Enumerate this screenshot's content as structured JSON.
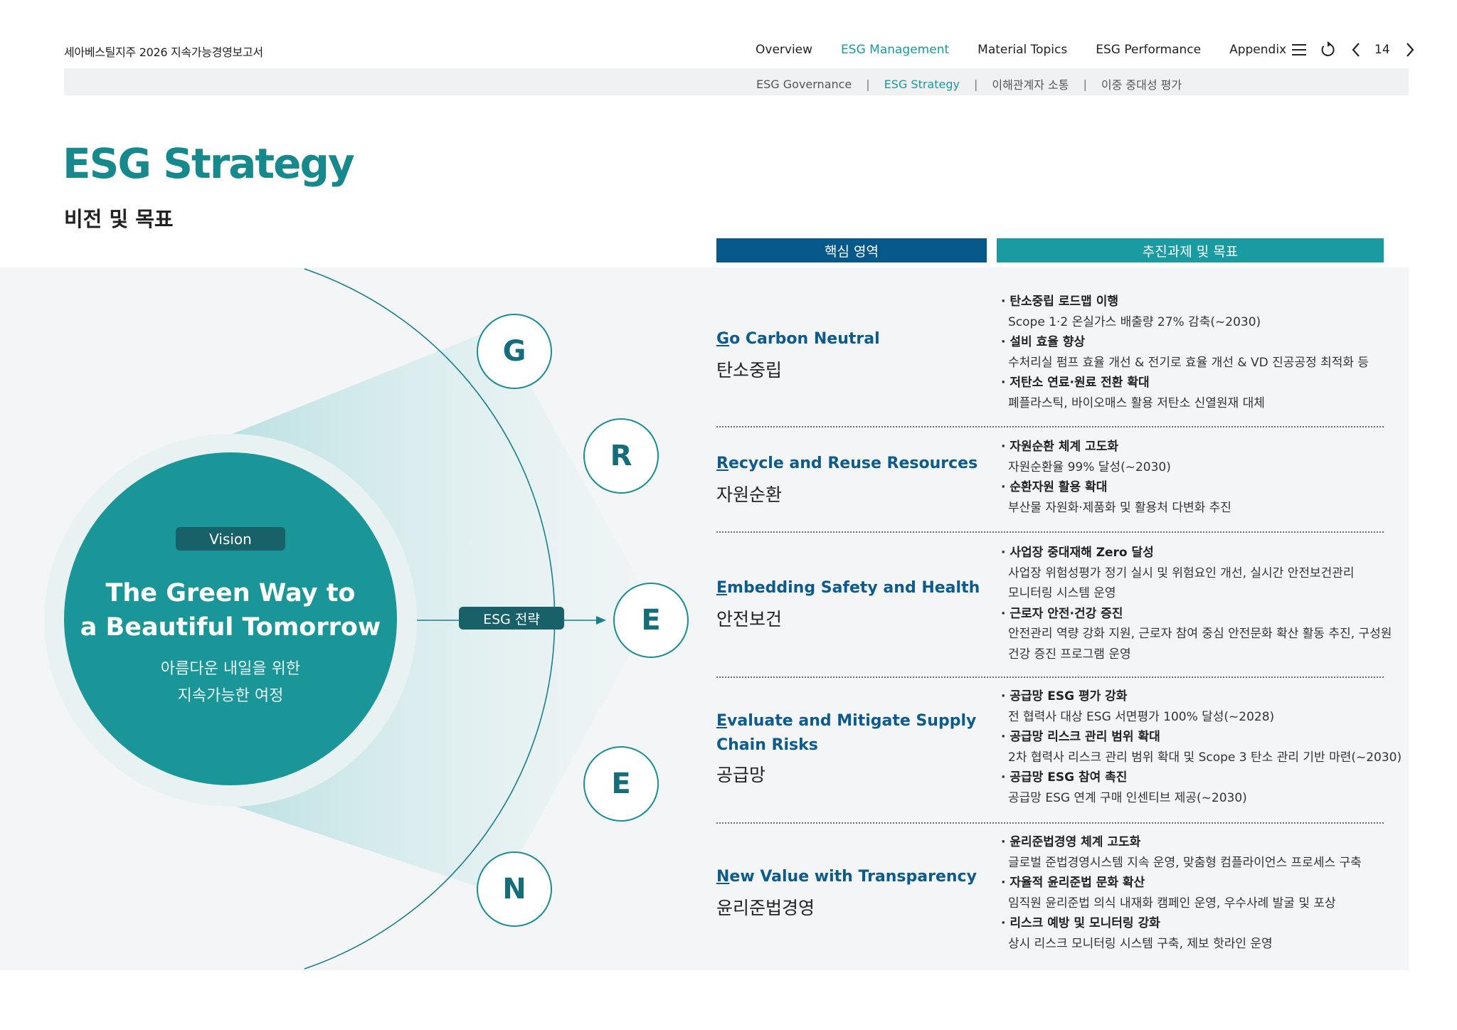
{
  "header": {
    "doc_title": "세아베스틸지주 2026 지속가능경영보고서",
    "nav": [
      {
        "label": "Overview"
      },
      {
        "label": "ESG Management"
      },
      {
        "label": "Material Topics"
      },
      {
        "label": "ESG Performance"
      },
      {
        "label": "Appendix"
      }
    ],
    "active_nav": "ESG Management",
    "page_number": "14",
    "icons": [
      "menu-icon",
      "refresh-icon",
      "prev-page-icon",
      "next-page-icon"
    ]
  },
  "subnav": {
    "items": [
      "ESG Governance",
      "ESG Strategy",
      "이해관계자 소통",
      "이중 중대성 평가"
    ],
    "separator": "|",
    "active": "ESG Strategy"
  },
  "page": {
    "title": "ESG Strategy",
    "subtitle": "비전 및 목표"
  },
  "table_headers": {
    "core_area": "핵심 영역",
    "tasks_goals": "추진과제 및 목표"
  },
  "vision": {
    "badge": "Vision",
    "english_line1": "The Green Way to",
    "english_line2": "a Beautiful Tomorrow",
    "korean_line1": "아름다운 내일을 위한",
    "korean_line2": "지속가능한 여정",
    "strategy_label": "ESG 전략"
  },
  "letters": [
    "G",
    "R",
    "E",
    "E",
    "N"
  ],
  "areas": [
    {
      "initial": "G",
      "english_rest": "o Carbon Neutral",
      "english_rest_line2": "",
      "korean": "탄소중립",
      "tasks": [
        {
          "title": "· 탄소중립 로드맵 이행",
          "desc": "Scope 1·2  온실가스 배출량 27% 감축(~2030)"
        },
        {
          "title": "· 설비 효율 향상",
          "desc": "수처리실 펌프 효율 개선 & 전기로 효율 개선 & VD 진공공정 최적화 등"
        },
        {
          "title": "· 저탄소 연료·원료 전환 확대",
          "desc": "폐플라스틱, 바이오매스 활용 저탄소 신열원재 대체"
        }
      ]
    },
    {
      "initial": "R",
      "english_rest": "ecycle and Reuse Resources",
      "english_rest_line2": "",
      "korean": "자원순환",
      "tasks": [
        {
          "title": "· 자원순환 체계 고도화",
          "desc": "자원순환율 99% 달성(~2030)"
        },
        {
          "title": "· 순환자원 활용 확대",
          "desc": "부산물 자원화·제품화 및 활용처 다변화 추진"
        }
      ]
    },
    {
      "initial": "E",
      "english_rest": "mbedding Safety and Health",
      "english_rest_line2": "",
      "korean": "안전보건",
      "tasks": [
        {
          "title": "· 사업장 중대재해 Zero 달성",
          "desc": "사업장 위험성평가 정기 실시 및 위험요인 개선, 실시간 안전보건관리",
          "desc2": "모니터링 시스템 운영"
        },
        {
          "title": "· 근로자 안전·건강 증진",
          "desc": "안전관리 역량 강화 지원, 근로자 참여 중심 안전문화 확산 활동 추진, 구성원",
          "desc2": "건강 증진 프로그램 운영"
        }
      ]
    },
    {
      "initial": "E",
      "english_rest": "valuate and Mitigate Supply",
      "english_rest_line2": "Chain Risks",
      "korean": "공급망",
      "tasks": [
        {
          "title": "· 공급망 ESG 평가 강화",
          "desc": "전 협력사 대상 ESG 서면평가 100% 달성(~2028)"
        },
        {
          "title": "· 공급망 리스크 관리 범위 확대",
          "desc": "2차 협력사 리스크 관리 범위 확대 및 Scope 3 탄소 관리 기반 마련(~2030)"
        },
        {
          "title": "· 공급망 ESG 참여 촉진",
          "desc": "공급망 ESG 연계 구매 인센티브 제공(~2030)"
        }
      ]
    },
    {
      "initial": "N",
      "english_rest": "ew Value with Transparency",
      "english_rest_line2": "",
      "korean": "윤리준법경영",
      "tasks": [
        {
          "title": "· 윤리준법경영 체계 고도화",
          "desc": "글로벌 준법경영시스템 지속 운영, 맞춤형 컴플라이언스 프로세스 구축"
        },
        {
          "title": "· 자율적 윤리준법 문화 확산",
          "desc": "임직원 윤리준법 의식 내재화 캠페인 운영, 우수사례 발굴 및 포상"
        },
        {
          "title": "· 리스크 예방 및 모니터링 강화",
          "desc": "상시 리스크 모니터링 시스템 구축, 제보 핫라인 운영"
        }
      ]
    }
  ],
  "colors": {
    "teal_primary": "#1a9598",
    "teal_dark": "#186169",
    "navy": "#06588a",
    "header_teal": "#1a9ba2",
    "title_teal": "#17898d",
    "panel_bg": "#f3f5f6"
  }
}
